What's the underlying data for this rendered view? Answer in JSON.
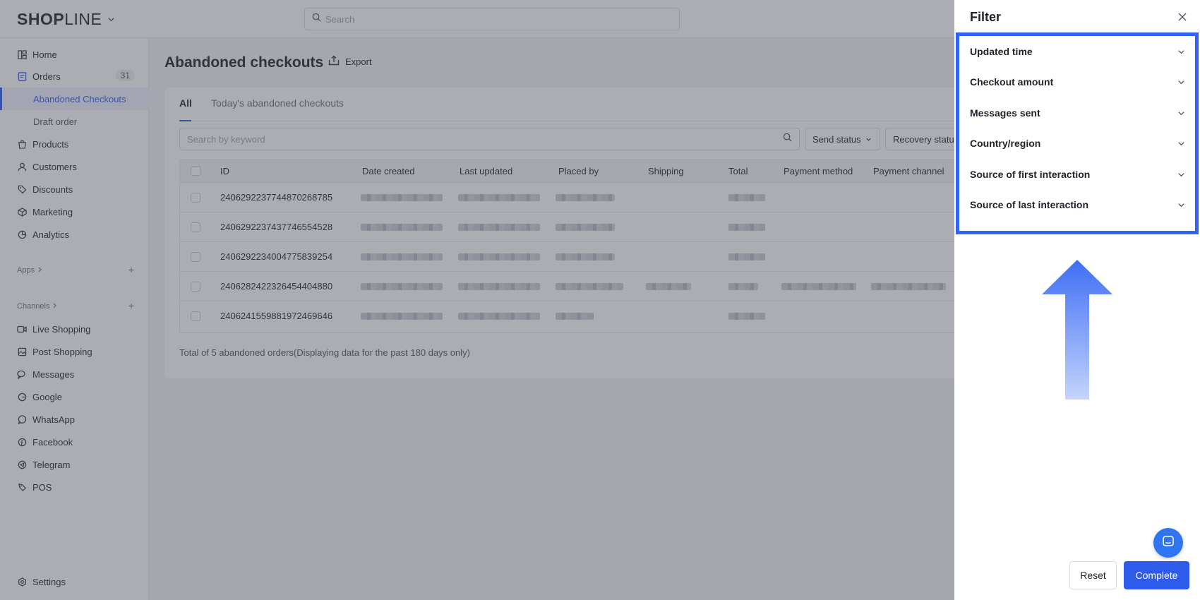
{
  "app": {
    "logo_main": "SHOP",
    "logo_light": "LINE",
    "search_placeholder": "Search"
  },
  "sidebar": {
    "home": "Home",
    "orders": "Orders",
    "orders_count": "31",
    "abandoned_checkouts": "Abandoned Checkouts",
    "draft_order": "Draft order",
    "products": "Products",
    "customers": "Customers",
    "discounts": "Discounts",
    "marketing": "Marketing",
    "analytics": "Analytics",
    "apps_section": "Apps",
    "channels_section": "Channels",
    "live_shopping": "Live Shopping",
    "post_shopping": "Post Shopping",
    "messages": "Messages",
    "google": "Google",
    "whatsapp": "WhatsApp",
    "facebook": "Facebook",
    "telegram": "Telegram",
    "pos": "POS",
    "settings": "Settings"
  },
  "main": {
    "title": "Abandoned checkouts",
    "export_label": "Export",
    "tabs": [
      "All",
      "Today's abandoned checkouts"
    ],
    "keyword_placeholder": "Search by keyword",
    "send_status": "Send status",
    "recovery_status": "Recovery status",
    "columns": [
      "ID",
      "Date created",
      "Last updated",
      "Placed by",
      "Shipping",
      "Total",
      "Payment method",
      "Payment channel"
    ],
    "rows": [
      {
        "id": "2406292237744870268785"
      },
      {
        "id": "2406292237437746554528"
      },
      {
        "id": "2406292234004775839254"
      },
      {
        "id": "2406282422326454404880"
      },
      {
        "id": "2406241559881972469646"
      }
    ],
    "footer_note": "Total of 5 abandoned orders(Displaying data for the past 180 days only)"
  },
  "filter": {
    "title": "Filter",
    "items": [
      "Updated time",
      "Checkout amount",
      "Messages sent",
      "Country/region",
      "Source of first interaction",
      "Source of last interaction"
    ],
    "reset_label": "Reset",
    "complete_label": "Complete"
  },
  "colors": {
    "accent": "#2f5bea",
    "highlight_border": "#2f64f5"
  }
}
